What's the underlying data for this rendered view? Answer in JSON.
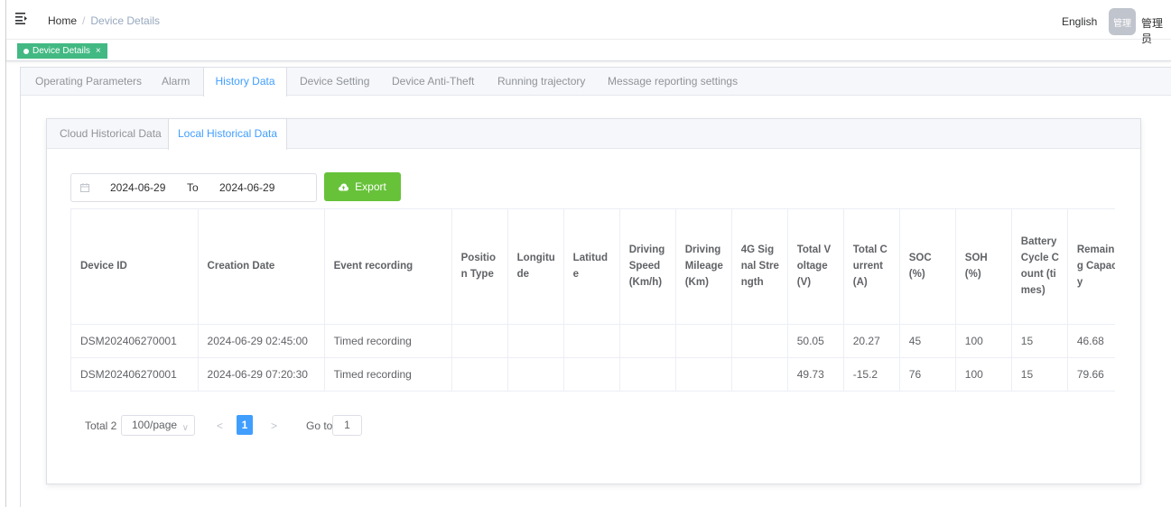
{
  "header": {
    "breadcrumb": {
      "home": "Home",
      "separator": "/",
      "current": "Device Details"
    },
    "language": "English",
    "avatar_text": "管理",
    "username": "管理员",
    "menu_icon": "hamburger-icon"
  },
  "tags_view": {
    "active_tag": "Device Details",
    "close_symbol": "×"
  },
  "outer_tabs": [
    {
      "label": "Operating Parameters",
      "active": false
    },
    {
      "label": "Alarm",
      "active": false
    },
    {
      "label": "History Data",
      "active": true
    },
    {
      "label": "Device Setting",
      "active": false
    },
    {
      "label": "Device Anti-Theft",
      "active": false
    },
    {
      "label": "Running trajectory",
      "active": false
    },
    {
      "label": "Message reporting settings",
      "active": false
    }
  ],
  "inner_tabs": [
    {
      "label": "Cloud Historical Data",
      "active": false
    },
    {
      "label": "Local Historical Data",
      "active": true
    }
  ],
  "date_range": {
    "start": "2024-06-29",
    "separator": "To",
    "end": "2024-06-29",
    "icon": "calendar-icon"
  },
  "export_button": {
    "label": "Export",
    "icon": "cloud-upload-icon",
    "color": "#67c23a"
  },
  "table": {
    "columns": [
      "Device ID",
      "Creation Date",
      "Event recording",
      "Position Type",
      "Longitude",
      "Latitude",
      "Driving Speed (Km/h)",
      "Driving Mileage (Km)",
      "4G Signal Strength",
      "Total Voltage (V)",
      "Total Current (A)",
      "SOC (%)",
      "SOH (%)",
      "Battery Cycle Count (times)",
      "Remaining Capacity"
    ],
    "rows": [
      [
        "DSM202406270001",
        "2024-06-29 02:45:00",
        "Timed recording",
        "",
        "",
        "",
        "",
        "",
        "",
        "50.05",
        "20.27",
        "45",
        "100",
        "15",
        "46.68"
      ],
      [
        "DSM202406270001",
        "2024-06-29 07:20:30",
        "Timed recording",
        "",
        "",
        "",
        "",
        "",
        "",
        "49.73",
        "-15.2",
        "76",
        "100",
        "15",
        "79.66"
      ]
    ]
  },
  "pagination": {
    "total_label": "Total 2",
    "page_size": "100/page",
    "prev": "<",
    "current_page": "1",
    "next": ">",
    "goto_label": "Go to",
    "goto_value": "1"
  },
  "colors": {
    "primary": "#409eff",
    "success": "#67c23a",
    "tag_green": "#42b983"
  }
}
